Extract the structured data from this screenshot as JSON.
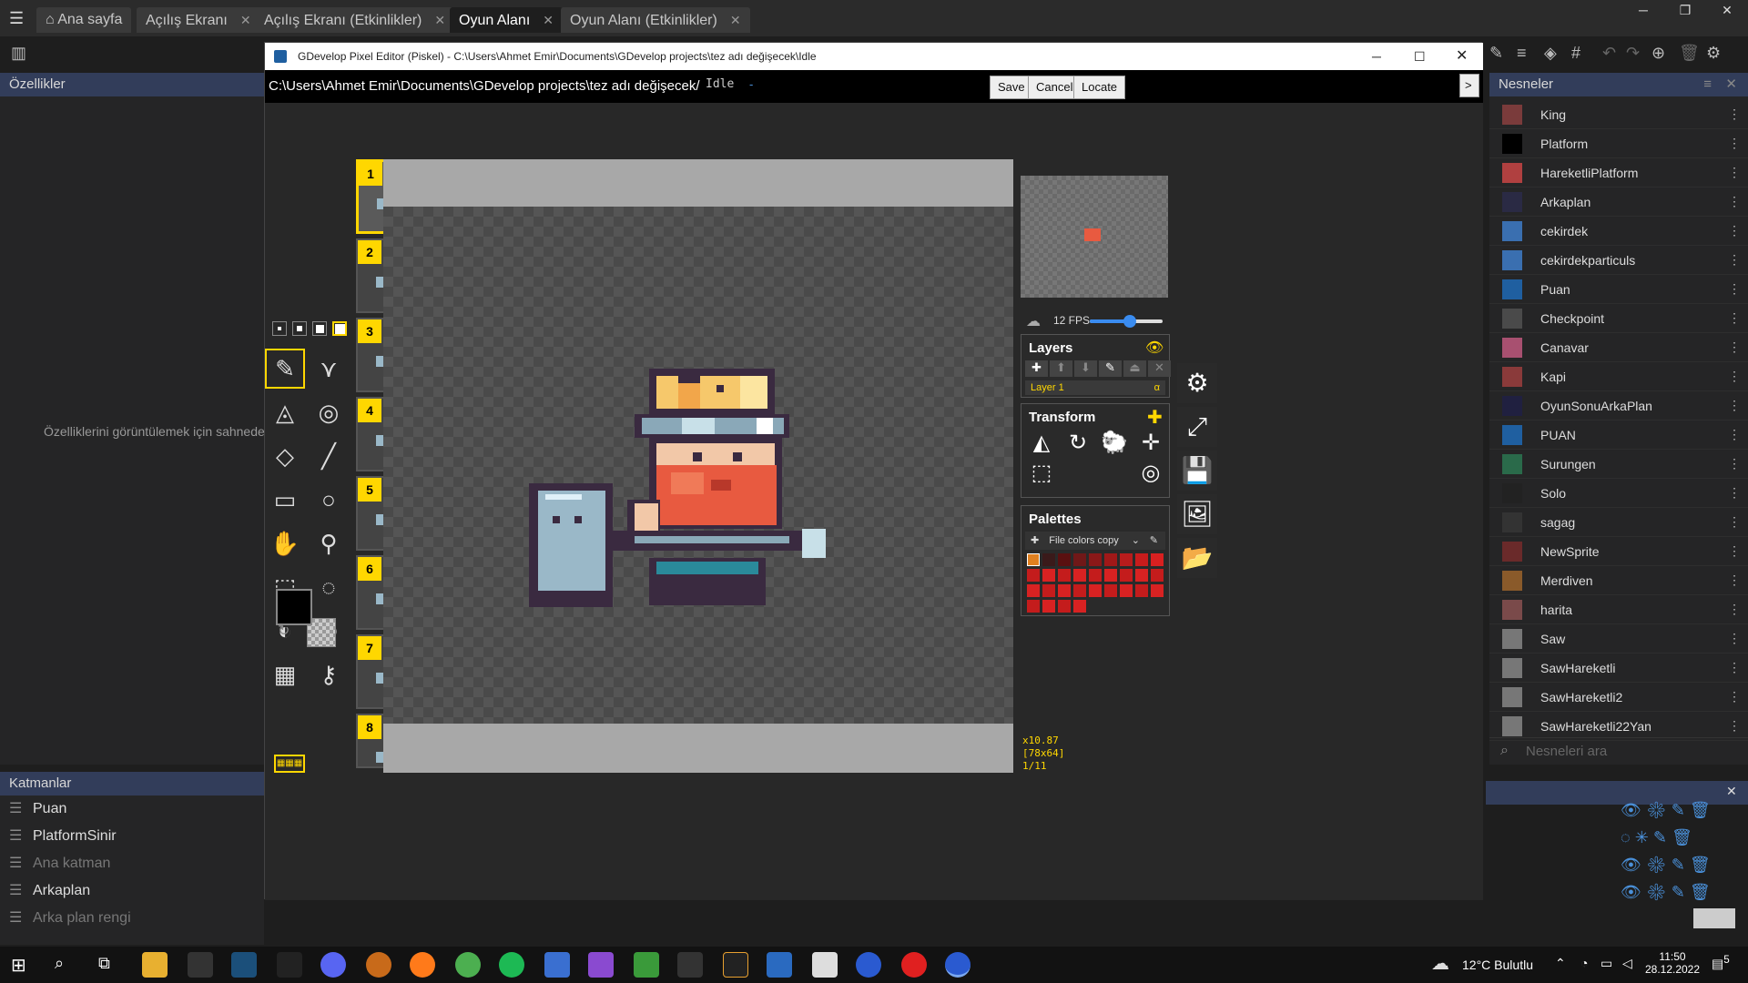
{
  "gdevelop": {
    "tabs": [
      "Ana sayfa",
      "Açılış Ekranı",
      "Açılış Ekranı (Etkinlikler)",
      "Oyun Alanı",
      "Oyun Alanı (Etkinlikler)"
    ],
    "properties_title": "Özellikler",
    "properties_hint": "Özelliklerini görüntülemek için sahnede",
    "layers_title": "Katmanlar",
    "layers": [
      "Puan",
      "PlatformSinir",
      "Ana katman",
      "Arkaplan",
      "Arka plan rengi"
    ],
    "objects_title": "Nesneler",
    "objects": [
      {
        "name": "King",
        "color": "#7a3b3b"
      },
      {
        "name": "Platform",
        "color": "#000000"
      },
      {
        "name": "HareketliPlatform",
        "color": "#b04040"
      },
      {
        "name": "Arkaplan",
        "color": "#2a2a44"
      },
      {
        "name": "cekirdek",
        "color": "#3a6fb0"
      },
      {
        "name": "cekirdekparticuls",
        "color": "#3a6fb0"
      },
      {
        "name": "Puan",
        "color": "#1f5fa0"
      },
      {
        "name": "Checkpoint",
        "color": "#4a4a4a"
      },
      {
        "name": "Canavar",
        "color": "#a85070"
      },
      {
        "name": "Kapi",
        "color": "#8a3a3a"
      },
      {
        "name": "OyunSonuArkaPlan",
        "color": "#202040"
      },
      {
        "name": "PUAN",
        "color": "#1f5fa0"
      },
      {
        "name": "Surungen",
        "color": "#2a6a4a"
      },
      {
        "name": "Solo",
        "color": "#222222"
      },
      {
        "name": "sagag",
        "color": "#333333"
      },
      {
        "name": "NewSprite",
        "color": "#6a2a2a"
      },
      {
        "name": "Merdiven",
        "color": "#8a5a2a"
      },
      {
        "name": "harita",
        "color": "#7a4a4a"
      },
      {
        "name": "Saw",
        "color": "#777777"
      },
      {
        "name": "SawHareketli",
        "color": "#777777"
      },
      {
        "name": "SawHareketli2",
        "color": "#777777"
      },
      {
        "name": "SawHareketli22Yan",
        "color": "#777777"
      }
    ],
    "search_placeholder": "Nesneleri ara"
  },
  "piskel": {
    "window_title": "GDevelop Pixel Editor (Piskel) - C:\\Users\\Ahmet Emir\\Documents\\GDevelop projects\\tez adı değişecek\\Idle",
    "path": "C:\\Users\\Ahmet Emir\\Documents\\GDevelop projects\\tez adı değişecek/",
    "file_name": "Idle",
    "file_suffix": "-",
    "buttons": {
      "save": "Save",
      "cancel": "Cancel",
      "locate": "Locate",
      "expand": ">"
    },
    "frames": [
      "1",
      "2",
      "3",
      "4",
      "5",
      "6",
      "7",
      "8"
    ],
    "fps_label": "12 FPS",
    "fps_level": 0.55,
    "layers_title": "Layers",
    "layer_name": "Layer 1",
    "layer_alpha": "α",
    "transform_title": "Transform",
    "palettes_title": "Palettes",
    "palette_name": "File colors copy",
    "zoom": "x10.87",
    "size": "[78x64]",
    "frame_index": "1/11",
    "primary_color": "#000000"
  },
  "taskbar": {
    "weather": "12°C  Bulutlu",
    "time": "11:50",
    "date": "28.12.2022",
    "notifications": "5"
  }
}
